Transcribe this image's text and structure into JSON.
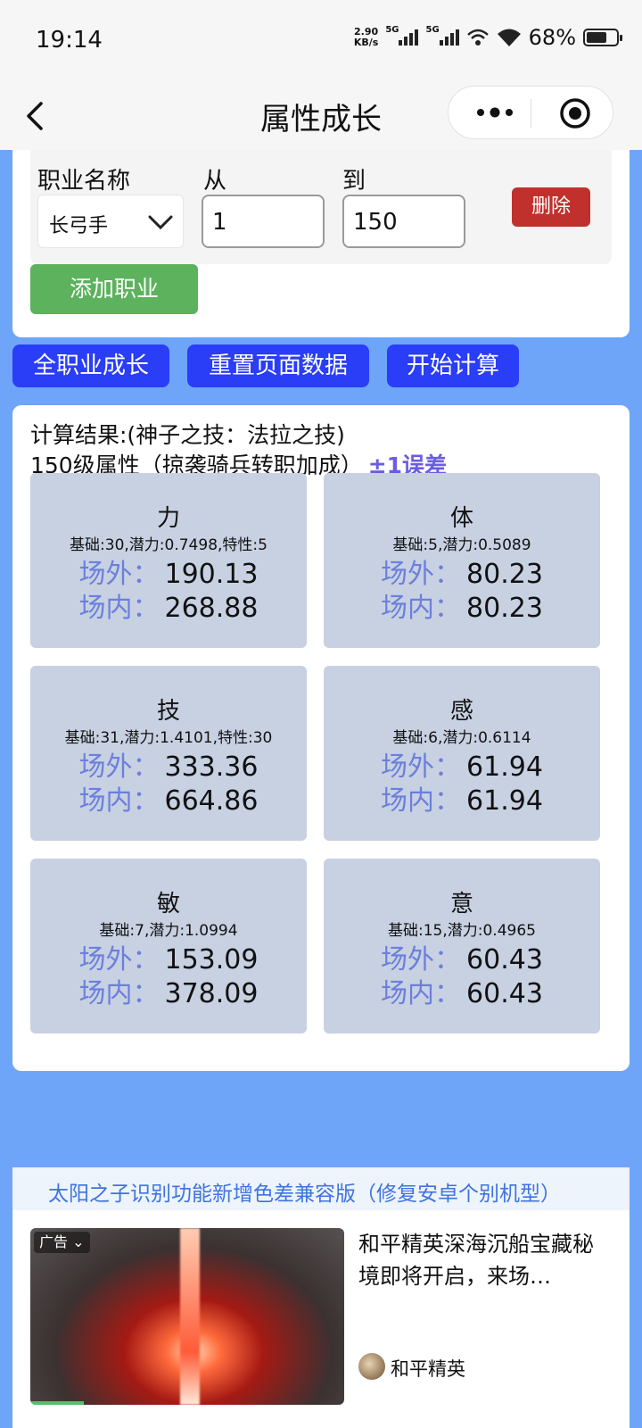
{
  "status_bar": {
    "time": "19:14",
    "net_speed_value": "2.90",
    "net_speed_unit": "KB/s",
    "sim1_label": "5G",
    "sim2_label": "5G",
    "battery_percent": "68%",
    "battery_level": 0.68
  },
  "nav": {
    "title": "属性成长"
  },
  "job_form": {
    "job_name_label": "职业名称",
    "from_label": "从",
    "to_label": "到",
    "job_selected": "长弓手",
    "from_value": "1",
    "to_value": "150",
    "delete_label": "删除",
    "add_job_label": "添加职业"
  },
  "actions": {
    "all_jobs": "全职业成长",
    "reset": "重置页面数据",
    "start": "开始计算"
  },
  "results": {
    "title": "计算结果:(神子之技：法拉之技)",
    "subtitle": "150级属性（掠袭骑兵转职加成）",
    "error_note": "±1误差",
    "outside_label": "场外：",
    "inside_label": "场内：",
    "stats": [
      {
        "name": "力",
        "meta": "基础:30,潜力:0.7498,特性:5",
        "outside": "190.13",
        "inside": "268.88"
      },
      {
        "name": "体",
        "meta": "基础:5,潜力:0.5089",
        "outside": "80.23",
        "inside": "80.23"
      },
      {
        "name": "技",
        "meta": "基础:31,潜力:1.4101,特性:30",
        "outside": "333.36",
        "inside": "664.86"
      },
      {
        "name": "感",
        "meta": "基础:6,潜力:0.6114",
        "outside": "61.94",
        "inside": "61.94"
      },
      {
        "name": "敏",
        "meta": "基础:7,潜力:1.0994",
        "outside": "153.09",
        "inside": "378.09"
      },
      {
        "name": "意",
        "meta": "基础:15,潜力:0.4965",
        "outside": "60.43",
        "inside": "60.43"
      }
    ]
  },
  "notice": {
    "text": "太阳之子识别功能新增色差兼容版（修复安卓个别机型）"
  },
  "ad": {
    "badge": "广告",
    "title": "和平精英深海沉船宝藏秘境即将开启，来场…",
    "source": "和平精英"
  },
  "colors": {
    "page_bg": "#6ea5f8",
    "primary_button": "#2a3df7",
    "add_button": "#5cb25d",
    "delete_button": "#c0302c",
    "stat_card": "#c8d1e2",
    "stat_label": "#6b7fdc",
    "error_note": "#6b5de0",
    "notice_text": "#3f73e0"
  }
}
